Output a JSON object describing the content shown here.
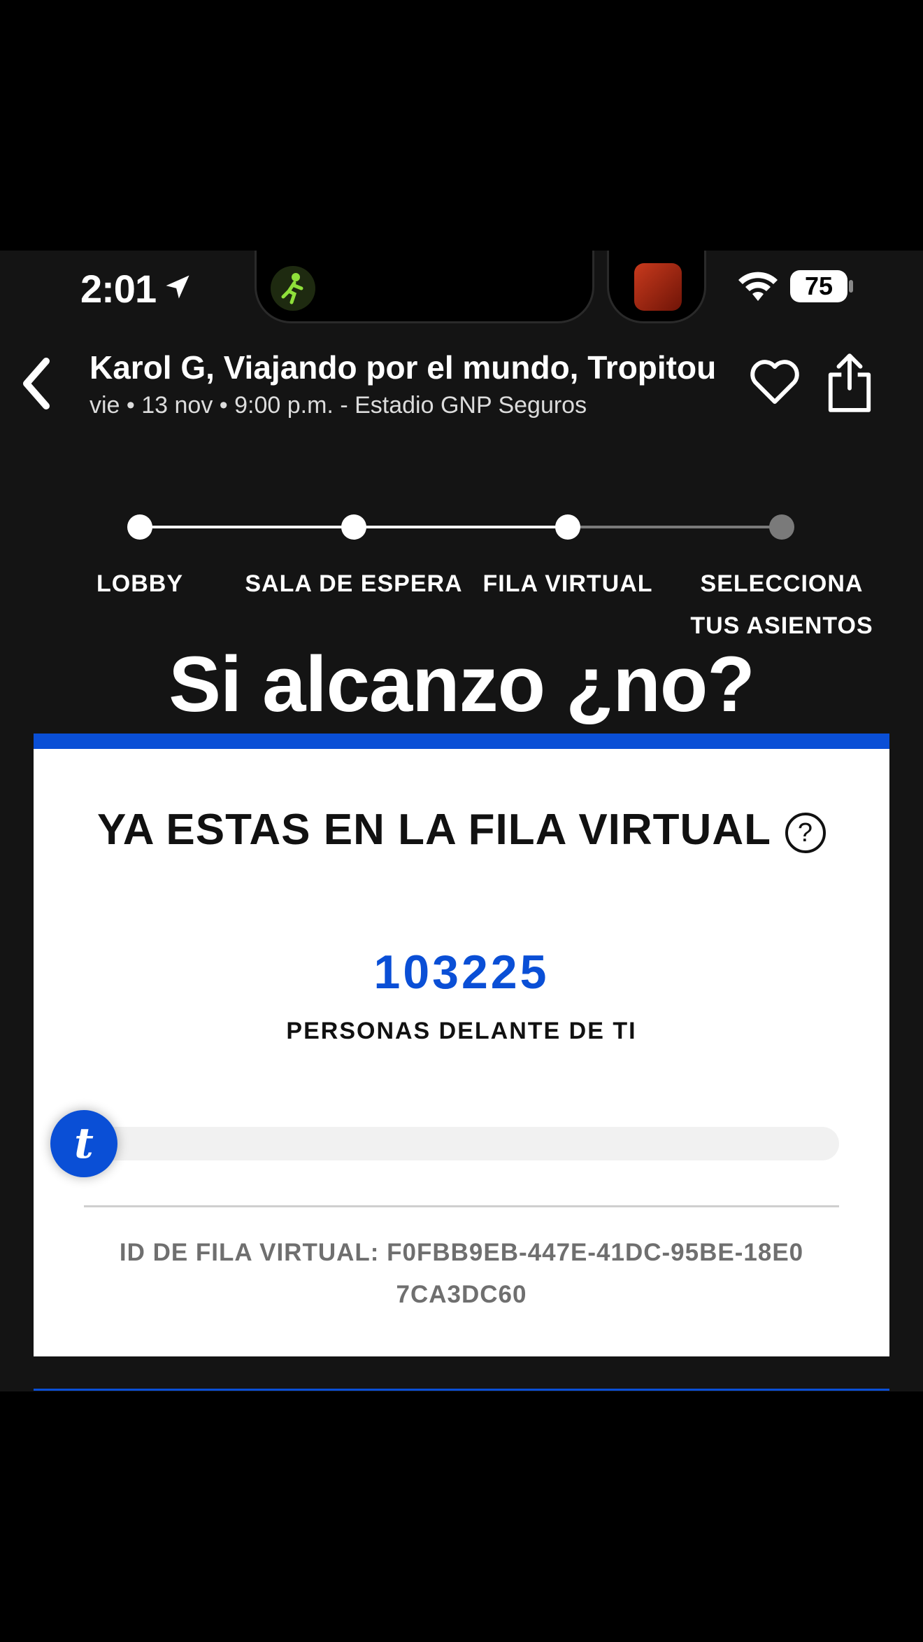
{
  "status_bar": {
    "time": "2:01",
    "battery": "75"
  },
  "header": {
    "title": "Karol G, Viajando por el mundo, Tropitour",
    "subtitle": "vie • 13 nov • 9:00 p.m. - Estadio GNP Seguros"
  },
  "steps": [
    {
      "label": "LOBBY",
      "state": "done"
    },
    {
      "label": "SALA DE ESPERA",
      "state": "done"
    },
    {
      "label": "FILA VIRTUAL",
      "state": "current"
    },
    {
      "label": "SELECCIONA TUS ASIENTOS",
      "state": "pending"
    }
  ],
  "headline": "Si alcanzo ¿no?",
  "queue": {
    "title": "YA ESTAS EN LA FILA VIRTUAL",
    "help_symbol": "?",
    "people_ahead": "103225",
    "people_ahead_label": "PERSONAS DELANTE DE TI",
    "progress_fraction": 0.0,
    "knob_letter": "t",
    "queue_id_label": "ID DE FILA VIRTUAL: F0FBB9EB-447E-41DC-95BE-18E07CA3DC60"
  },
  "colors": {
    "accent": "#0a4fd6",
    "background": "#141414",
    "card": "#ffffff",
    "step_done": "#ffffff",
    "step_pending": "#7a7a7a"
  }
}
